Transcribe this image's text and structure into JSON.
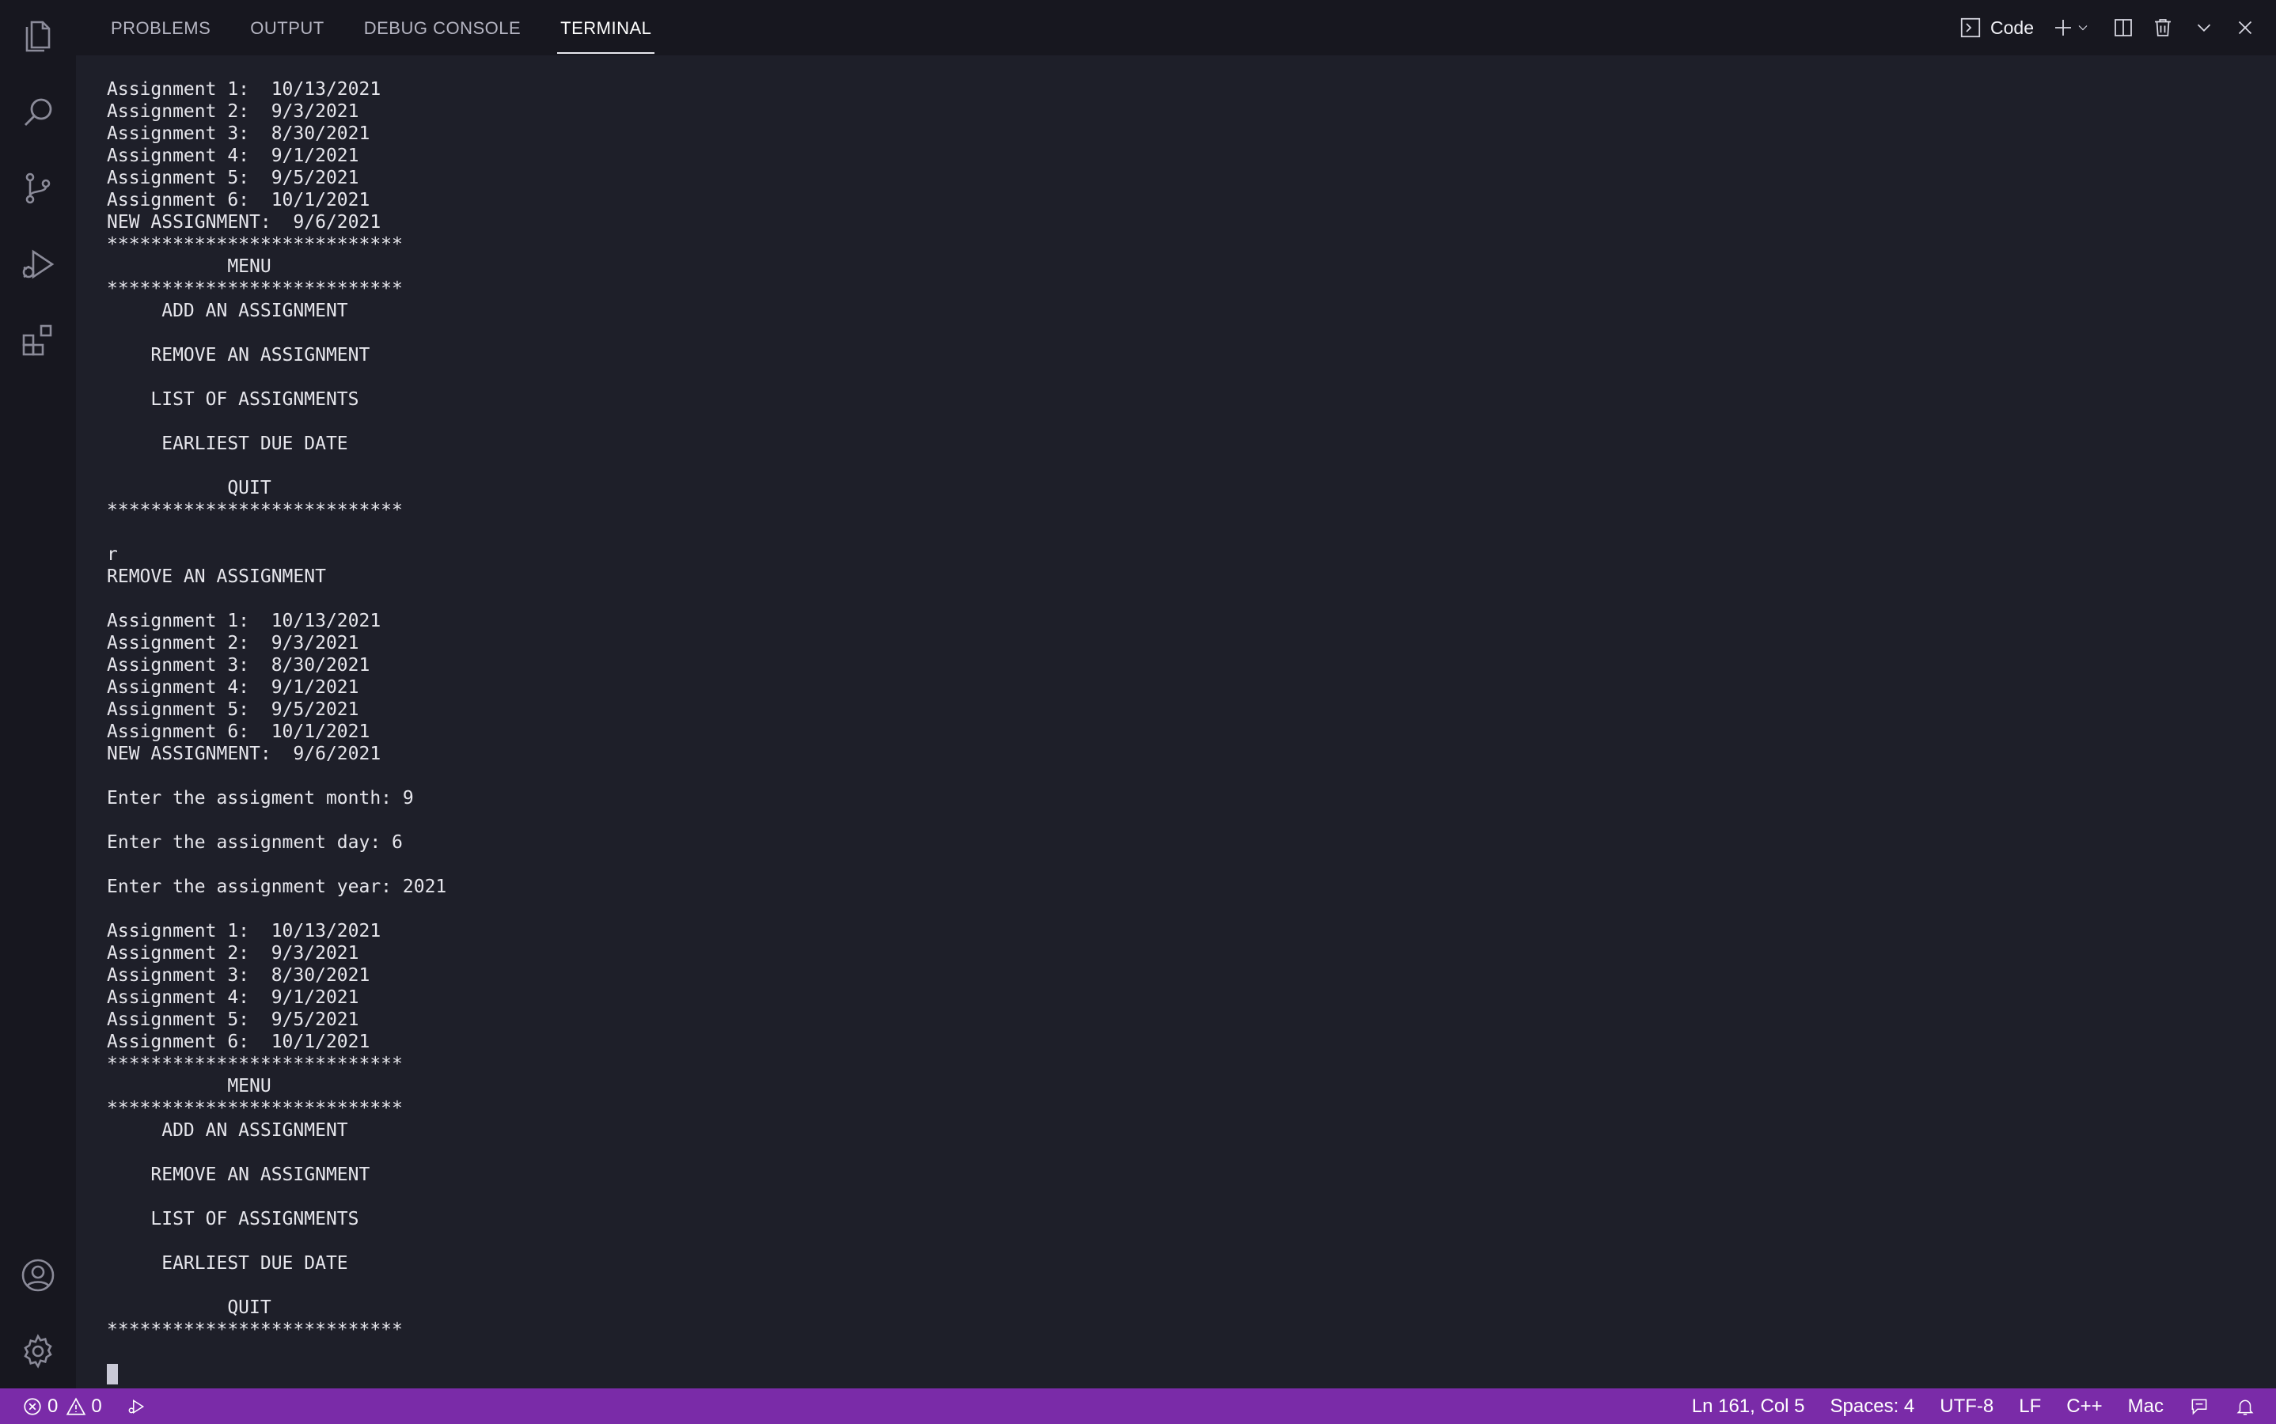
{
  "panel": {
    "tabs": [
      {
        "label": "PROBLEMS"
      },
      {
        "label": "OUTPUT"
      },
      {
        "label": "DEBUG CONSOLE"
      },
      {
        "label": "TERMINAL"
      }
    ],
    "active_tab": "TERMINAL",
    "terminal_profile_label": "Code"
  },
  "activity_bar": {
    "icons": [
      "explorer-icon",
      "search-icon",
      "source-control-icon",
      "run-debug-icon",
      "extensions-icon",
      "account-icon",
      "settings-gear-icon"
    ]
  },
  "terminal": {
    "lines": [
      "Assignment 1:  10/13/2021",
      "Assignment 2:  9/3/2021",
      "Assignment 3:  8/30/2021",
      "Assignment 4:  9/1/2021",
      "Assignment 5:  9/5/2021",
      "Assignment 6:  10/1/2021",
      "NEW ASSIGNMENT:  9/6/2021",
      "***************************",
      "           MENU",
      "***************************",
      "     ADD AN ASSIGNMENT",
      "",
      "    REMOVE AN ASSIGNMENT",
      "",
      "    LIST OF ASSIGNMENTS",
      "",
      "     EARLIEST DUE DATE",
      "",
      "           QUIT",
      "***************************",
      "",
      "r",
      "REMOVE AN ASSIGNMENT",
      "",
      "Assignment 1:  10/13/2021",
      "Assignment 2:  9/3/2021",
      "Assignment 3:  8/30/2021",
      "Assignment 4:  9/1/2021",
      "Assignment 5:  9/5/2021",
      "Assignment 6:  10/1/2021",
      "NEW ASSIGNMENT:  9/6/2021",
      "",
      "Enter the assigment month: 9",
      "",
      "Enter the assignment day: 6",
      "",
      "Enter the assignment year: 2021",
      "",
      "Assignment 1:  10/13/2021",
      "Assignment 2:  9/3/2021",
      "Assignment 3:  8/30/2021",
      "Assignment 4:  9/1/2021",
      "Assignment 5:  9/5/2021",
      "Assignment 6:  10/1/2021",
      "***************************",
      "           MENU",
      "***************************",
      "     ADD AN ASSIGNMENT",
      "",
      "    REMOVE AN ASSIGNMENT",
      "",
      "    LIST OF ASSIGNMENTS",
      "",
      "     EARLIEST DUE DATE",
      "",
      "           QUIT",
      "***************************"
    ]
  },
  "status_bar": {
    "errors": "0",
    "warnings": "0",
    "cursor_position": "Ln 161, Col 5",
    "indentation": "Spaces: 4",
    "encoding": "UTF-8",
    "eol": "LF",
    "language": "C++",
    "platform": "Mac"
  },
  "colors": {
    "status_bar": "#7a2ba8",
    "terminal_bg": "#1e1f29",
    "activity_bar_bg": "#17171f"
  }
}
